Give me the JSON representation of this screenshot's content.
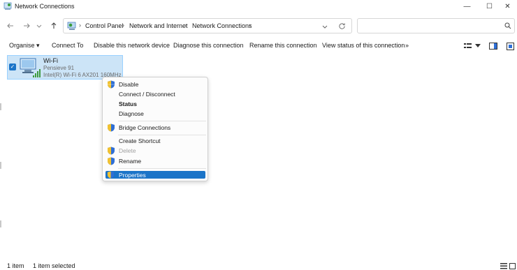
{
  "window": {
    "title": "Network Connections",
    "minimize_icon": "—",
    "maximize_icon": "☐",
    "close_icon": "✕"
  },
  "address_bar": {
    "breadcrumbs": [
      "Control Panel",
      "Network and Internet",
      "Network Connections"
    ],
    "separator": "›"
  },
  "search": {
    "placeholder": ""
  },
  "commands": {
    "organise": "Organise ▾",
    "connect_to": "Connect To",
    "disable_device": "Disable this network device",
    "diagnose": "Diagnose this connection",
    "rename": "Rename this connection",
    "view_status": "View status of this connection",
    "more": "»"
  },
  "connection": {
    "name": "Wi-Fi",
    "network": "Pensieve 91",
    "adapter": "Intel(R) Wi-Fi 6 AX201 160MHz",
    "checked": true
  },
  "context_menu": {
    "items": [
      {
        "label": "Disable",
        "icon": "shield-icon",
        "bold": false,
        "disabled": false
      },
      {
        "label": "Connect / Disconnect",
        "icon": "",
        "bold": false,
        "disabled": false
      },
      {
        "label": "Status",
        "icon": "",
        "bold": true,
        "disabled": false
      },
      {
        "label": "Diagnose",
        "icon": "",
        "bold": false,
        "disabled": false
      },
      {
        "label": "Bridge Connections",
        "icon": "shield-icon",
        "bold": false,
        "disabled": false
      },
      {
        "label": "Create Shortcut",
        "icon": "",
        "bold": false,
        "disabled": false
      },
      {
        "label": "Delete",
        "icon": "shield-icon",
        "bold": false,
        "disabled": true
      },
      {
        "label": "Rename",
        "icon": "shield-icon",
        "bold": false,
        "disabled": false
      },
      {
        "label": "Properties",
        "icon": "shield-icon",
        "bold": false,
        "disabled": false,
        "highlighted": true
      }
    ]
  },
  "status_bar": {
    "count": "1 item",
    "selected": "1 item selected"
  },
  "colors": {
    "accent": "#1b74c8",
    "selection": "#cce4f7",
    "shield_blue": "#2f6fd6",
    "shield_yellow": "#f2c230"
  }
}
